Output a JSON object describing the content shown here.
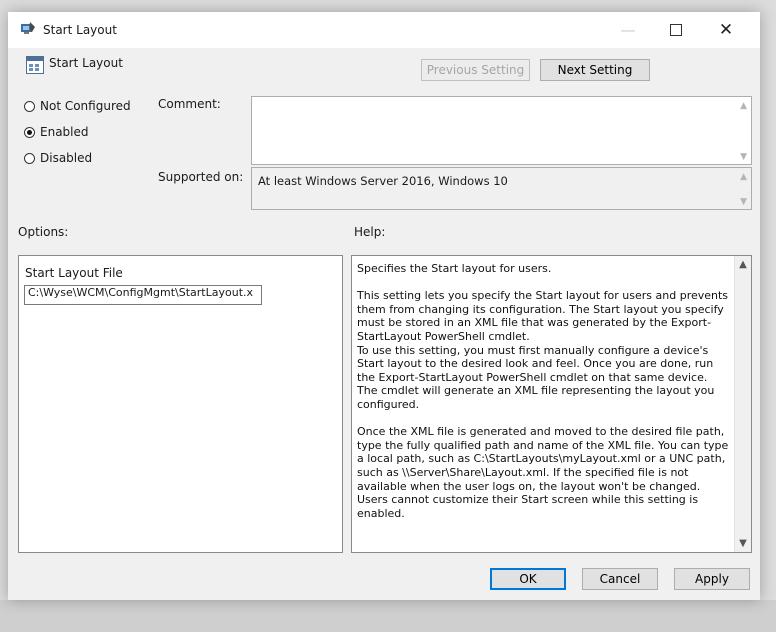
{
  "window": {
    "title": "Start Layout",
    "minimize_glyph": "—",
    "close_glyph": "✕"
  },
  "header": {
    "title": "Start Layout",
    "previous_label": "Previous Setting",
    "next_label": "Next Setting"
  },
  "state": {
    "options": [
      {
        "label": "Not Configured",
        "checked": false
      },
      {
        "label": "Enabled",
        "checked": true
      },
      {
        "label": "Disabled",
        "checked": false
      }
    ]
  },
  "comment": {
    "label": "Comment:",
    "value": ""
  },
  "supported": {
    "label": "Supported on:",
    "value": "At least Windows Server 2016, Windows 10"
  },
  "options_panel": {
    "heading": "Options:",
    "field_label": "Start Layout File",
    "field_value": "C:\\Wyse\\WCM\\ConfigMgmt\\StartLayout.x"
  },
  "help_panel": {
    "heading": "Help:",
    "paragraphs": [
      "Specifies the Start layout for users.",
      "This setting lets you specify the Start layout for users and prevents them from changing its configuration. The Start layout you specify must be stored in an XML file that was generated by the Export-StartLayout PowerShell cmdlet.\nTo use this setting, you must first manually configure a device's Start layout to the desired look and feel. Once you are done, run the Export-StartLayout PowerShell cmdlet on that same device. The cmdlet will generate an XML file representing the layout you configured.",
      "Once the XML file is generated and moved to the desired file path, type the fully qualified path and name of the XML file. You can type a local path, such as C:\\StartLayouts\\myLayout.xml or a UNC path, such as \\\\Server\\Share\\Layout.xml. If the specified file is not available when the user logs on, the layout won't be changed. Users cannot customize their Start screen while this setting is enabled."
    ]
  },
  "footer": {
    "ok_label": "OK",
    "cancel_label": "Cancel",
    "apply_label": "Apply"
  },
  "icons": {
    "title": "policy-app-icon",
    "header": "policy-setting-icon",
    "minimize": "minimize-icon",
    "maximize": "maximize-icon",
    "close": "close-icon",
    "scroll_up": "scroll-up-icon",
    "scroll_down": "scroll-down-icon"
  },
  "colors": {
    "focus_accent": "#0078d7",
    "window_bg": "#f0f0f0"
  }
}
